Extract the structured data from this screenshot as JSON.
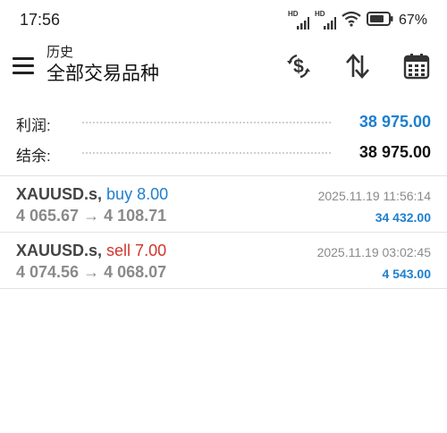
{
  "status_bar": {
    "time": "17:56",
    "signal_label_1": "HD",
    "signal_label_2": "HD",
    "battery_percent": "67%"
  },
  "header": {
    "subtitle": "历史",
    "title": "全部交易品种"
  },
  "summary": {
    "profit_label": "利润:",
    "profit_value": "38 975.00",
    "balance_label": "结余:",
    "balance_value": "38 975.00"
  },
  "trades": [
    {
      "symbol": "XAUUSD.s,",
      "action": "buy 8.00",
      "open_price": "4 065.67",
      "arrow": "→",
      "close_price": "4 108.71",
      "timestamp": "2025.11.19 11:56:14",
      "profit": "34 432.00"
    },
    {
      "symbol": "XAUUSD.s,",
      "action": "sell 7.00",
      "open_price": "4 074.56",
      "arrow": "→",
      "close_price": "4 068.07",
      "timestamp": "2025.11.19 03:02:45",
      "profit": "4 543.00"
    }
  ],
  "colors": {
    "blue": "#1e7fd0",
    "red": "#d0362a",
    "grey": "#8a8a8a"
  },
  "icons": [
    "menu-icon",
    "currency-exchange-icon",
    "sort-icon",
    "calendar-icon",
    "signal-icon",
    "wifi-icon",
    "battery-icon"
  ]
}
